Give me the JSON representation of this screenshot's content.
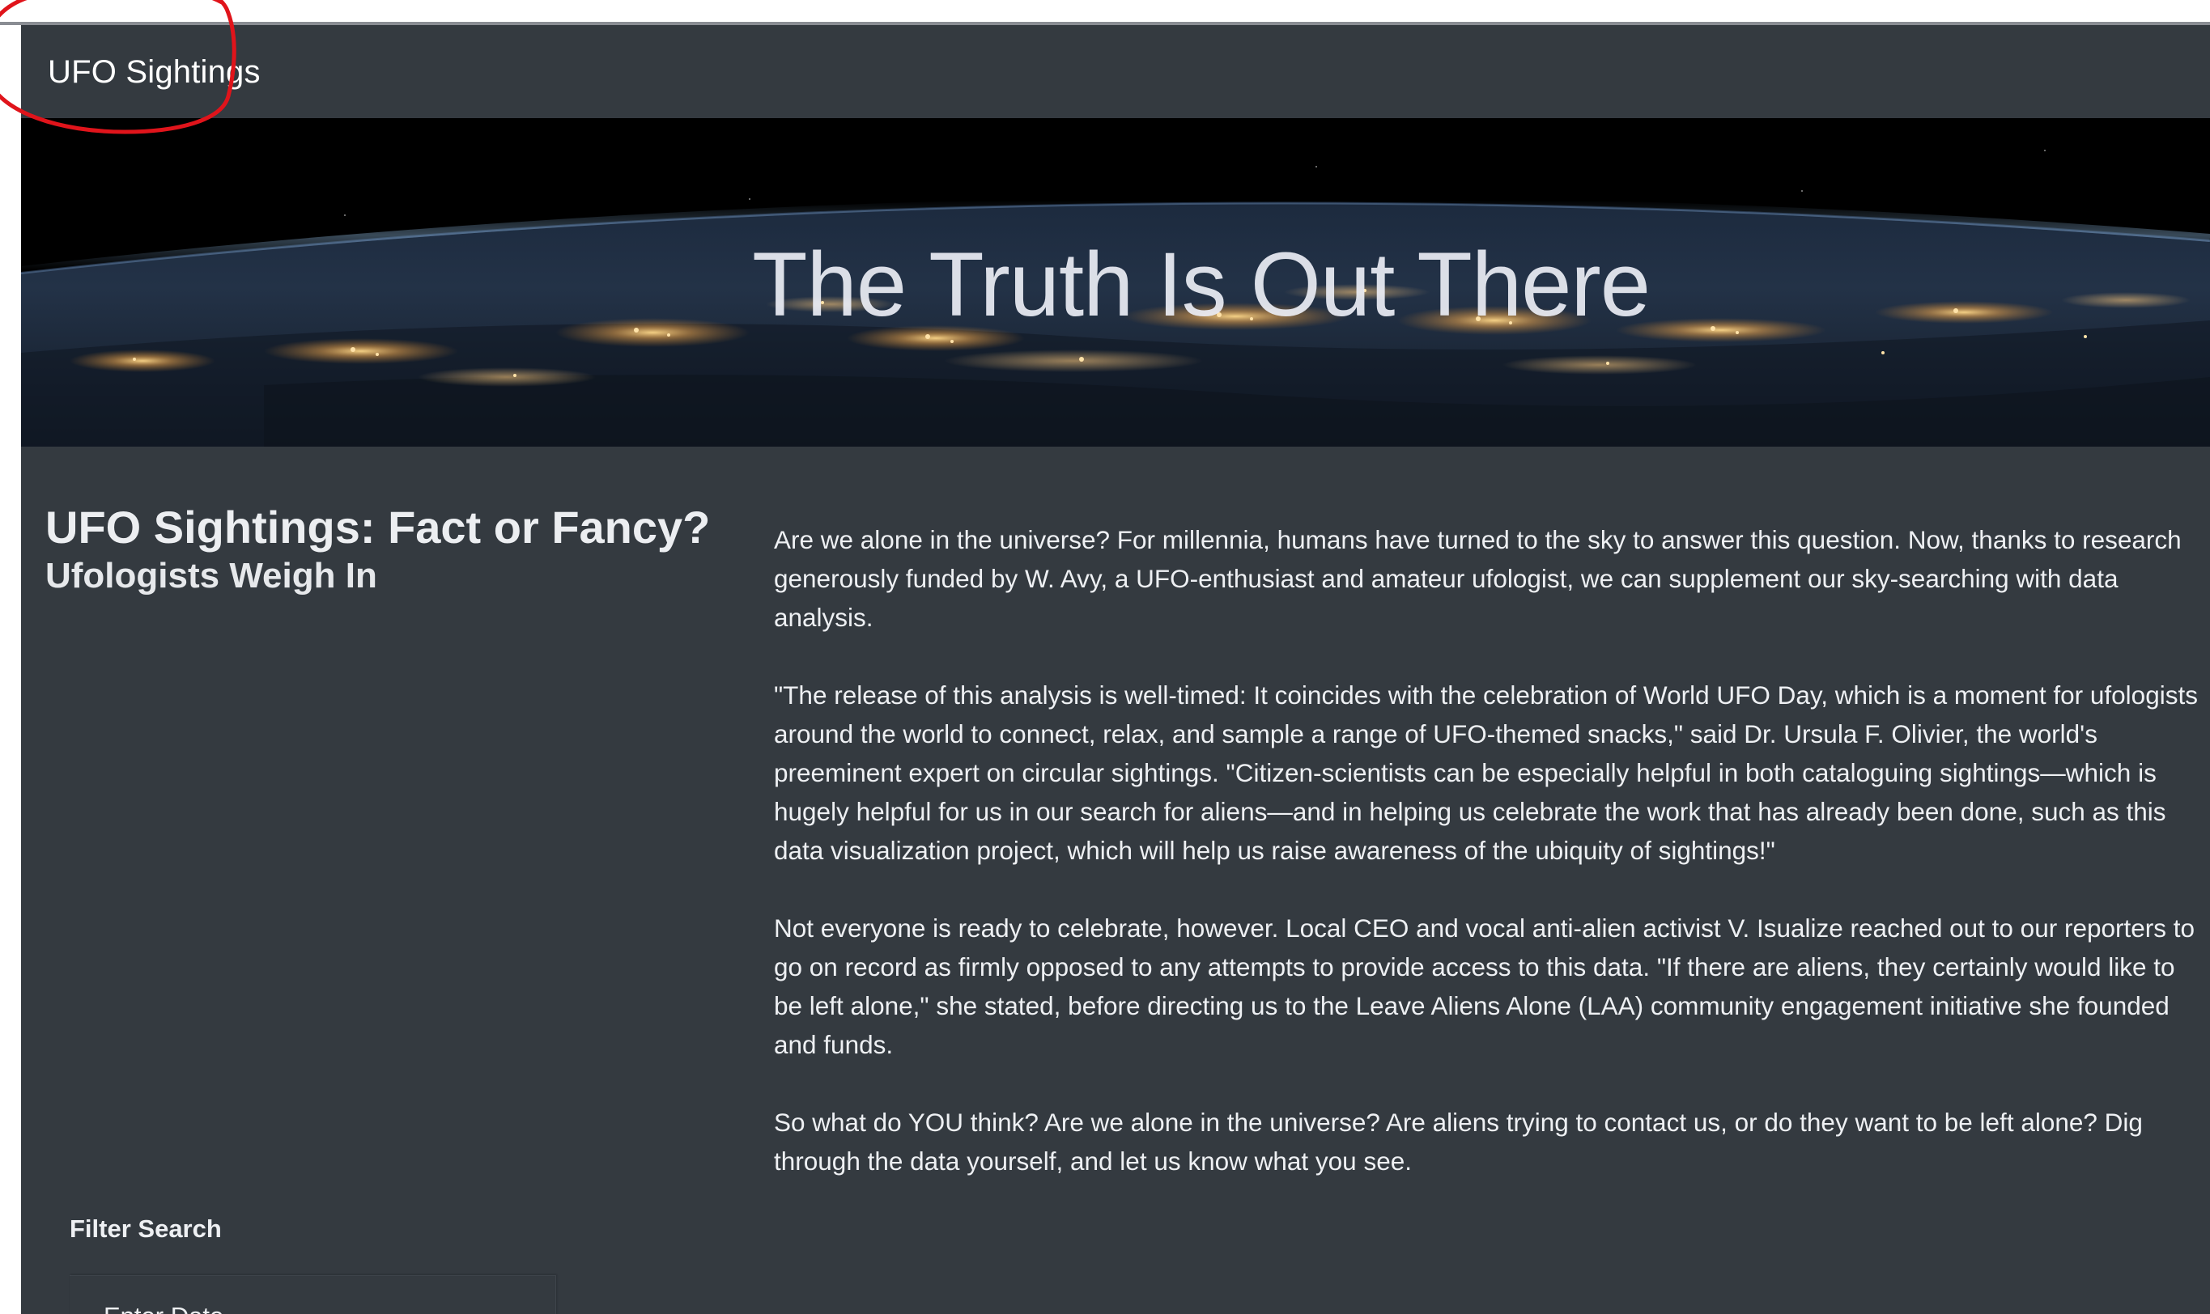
{
  "navbar": {
    "brand": "UFO Sightings"
  },
  "hero": {
    "title": "The Truth Is Out There"
  },
  "intro": {
    "headline": "UFO Sightings: Fact or Fancy?",
    "subhead": "Ufologists Weigh In"
  },
  "article": {
    "paragraphs": [
      "Are we alone in the universe? For millennia, humans have turned to the sky to answer this question. Now, thanks to research generously funded by W. Avy, a UFO-enthusiast and amateur ufologist, we can supplement our sky-searching with data analysis.",
      "\"The release of this analysis is well-timed: It coincides with the celebration of World UFO Day, which is a moment for ufologists around the world to connect, relax, and sample a range of UFO-themed snacks,\" said Dr. Ursula F. Olivier, the world's preeminent expert on circular sightings. \"Citizen-scientists can be especially helpful in both cataloguing sightings—which is hugely helpful for us in our search for aliens—and in helping us celebrate the work that has already been done, such as this data visualization project, which will help us raise awareness of the ubiquity of sightings!\"",
      "Not everyone is ready to celebrate, however. Local CEO and vocal anti-alien activist V. Isualize reached out to our reporters to go on record as firmly opposed to any attempts to provide access to this data. \"If there are aliens, they certainly would like to be left alone,\" she stated, before directing us to the Leave Aliens Alone (LAA) community engagement initiative she founded and funds.",
      "So what do YOU think? Are we alone in the universe? Are aliens trying to contact us, or do they want to be left alone? Dig through the data yourself, and let us know what you see."
    ]
  },
  "filters": {
    "title": "Filter Search",
    "date_label": "Enter Date"
  },
  "colors": {
    "page_bg": "#343a40",
    "annotation": "#e0141b"
  },
  "icons": {
    "hero_image": "earth-at-night-image"
  }
}
